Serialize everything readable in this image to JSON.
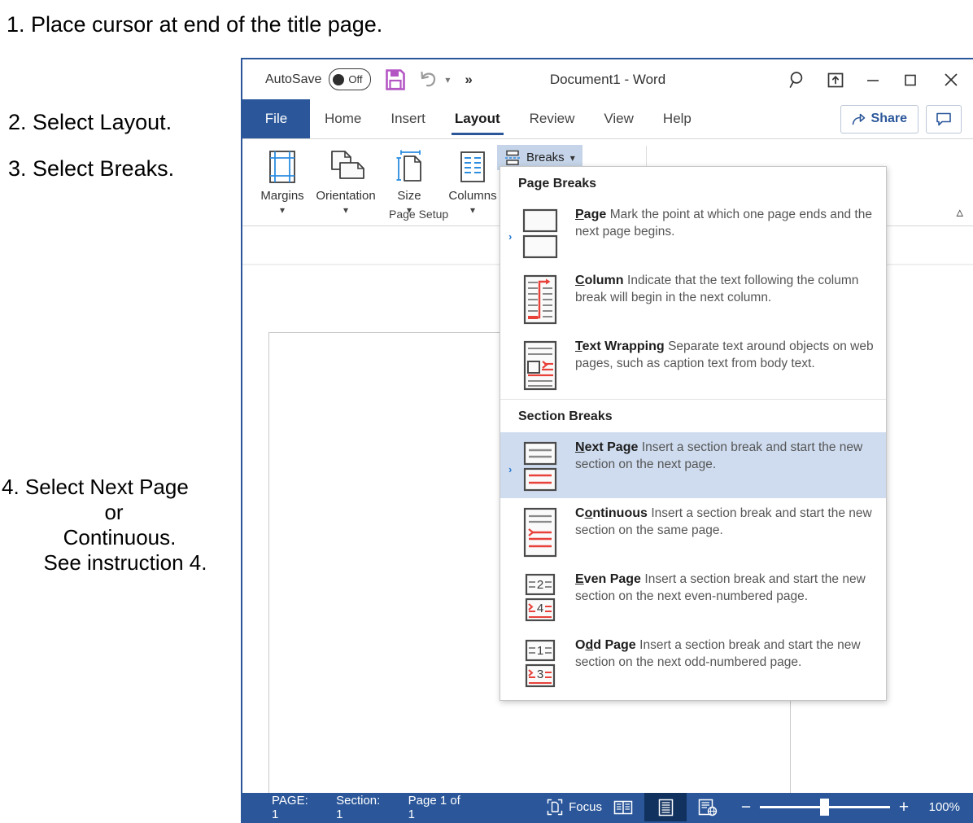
{
  "instructions": {
    "step1": "1. Place cursor at end of the title page.",
    "step2": "2. Select Layout.",
    "step3": "3. Select Breaks.",
    "step4_line1": "4. Select Next Page",
    "step4_line2": "or",
    "step4_line3": "Continuous.",
    "step4_line4": "See  instruction 4."
  },
  "titlebar": {
    "autosave_label": "AutoSave",
    "autosave_state": "Off",
    "document_title": "Document1  -  Word",
    "save_icon": "save-icon",
    "undo_icon": "undo-icon",
    "more_icon": "more-commands-icon",
    "search_icon": "search-icon",
    "restore_icon": "ribbon-display-options-icon",
    "minimize_label": "minimize-icon",
    "maximize_label": "maximize-icon",
    "close_label": "close-icon"
  },
  "tabs": [
    {
      "label": "File",
      "active": false,
      "is_file": true
    },
    {
      "label": "Home",
      "active": false
    },
    {
      "label": "Insert",
      "active": false
    },
    {
      "label": "Layout",
      "active": true
    },
    {
      "label": "Review",
      "active": false
    },
    {
      "label": "View",
      "active": false
    },
    {
      "label": "Help",
      "active": false
    }
  ],
  "tabbar_right": {
    "share_label": "Share",
    "comment_icon": "comment-icon"
  },
  "ribbon": {
    "items": [
      {
        "label": "Margins",
        "icon": "margins-icon"
      },
      {
        "label": "Orientation",
        "icon": "orientation-icon"
      },
      {
        "label": "Size",
        "icon": "size-icon"
      },
      {
        "label": "Columns",
        "icon": "columns-icon"
      }
    ],
    "breaks_label": "Breaks",
    "breaks_icon": "breaks-icon",
    "group_label": "Page Setup",
    "collapse_icon": "collapse-ribbon-icon"
  },
  "breaks_menu": {
    "page_breaks_header": "Page Breaks",
    "section_breaks_header": "Section Breaks",
    "page_breaks": [
      {
        "title": "Page",
        "accel": "P",
        "rest": "age",
        "desc": "Mark the point at which one page ends and the next page begins.",
        "icon": "page-break-icon",
        "selected": false,
        "marker": true
      },
      {
        "title": "Column",
        "accel": "C",
        "rest": "olumn",
        "desc": "Indicate that the text following the column break will begin in the next column.",
        "icon": "column-break-icon",
        "selected": false,
        "marker": false
      },
      {
        "title": "Text Wrapping",
        "accel": "T",
        "rest": "ext Wrapping",
        "desc": "Separate text around objects on web pages, such as caption text from body text.",
        "icon": "text-wrapping-break-icon",
        "selected": false,
        "marker": false
      }
    ],
    "section_breaks": [
      {
        "title": "Next Page",
        "accel": "N",
        "rest": "ext Page",
        "desc": "Insert a section break and start the new section on the next page.",
        "icon": "next-page-break-icon",
        "selected": true,
        "marker": true
      },
      {
        "title": "Continuous",
        "accel_pre": "C",
        "accel": "o",
        "rest": "ntinuous",
        "desc": "Insert a section break and start the new section on the same page.",
        "icon": "continuous-break-icon",
        "selected": false,
        "marker": false
      },
      {
        "title": "Even Page",
        "accel": "E",
        "rest": "ven Page",
        "desc": "Insert a section break and start the new section on the next even-numbered page.",
        "icon": "even-page-break-icon",
        "icon_numbers": [
          "2",
          "4"
        ],
        "selected": false,
        "marker": false
      },
      {
        "title": "Odd Page",
        "accel_pre": "O",
        "accel": "d",
        "rest": "d Page",
        "desc": "Insert a section break and start the new section on the next odd-numbered page.",
        "icon": "odd-page-break-icon",
        "icon_numbers": [
          "1",
          "3"
        ],
        "selected": false,
        "marker": false
      }
    ]
  },
  "statusbar": {
    "page_indicator": "PAGE: 1",
    "section_indicator": "Section: 1",
    "page_of": "Page 1 of 1",
    "focus_label": "Focus",
    "focus_icon": "focus-icon",
    "views": [
      {
        "name": "read-mode",
        "icon": "read-mode-icon",
        "active": false
      },
      {
        "name": "print-layout",
        "icon": "print-layout-icon",
        "active": true
      },
      {
        "name": "web-layout",
        "icon": "web-layout-icon",
        "active": false
      }
    ],
    "zoom_out": "−",
    "zoom_in": "+",
    "zoom_level": "100%"
  },
  "colors": {
    "word_blue": "#2b579a",
    "menu_selection": "#cfdcef",
    "breaks_button_active": "#c5d4e8",
    "accent_red": "#e8413a",
    "save_purple": "#b455c4",
    "icon_blue": "#2b8ce0"
  }
}
